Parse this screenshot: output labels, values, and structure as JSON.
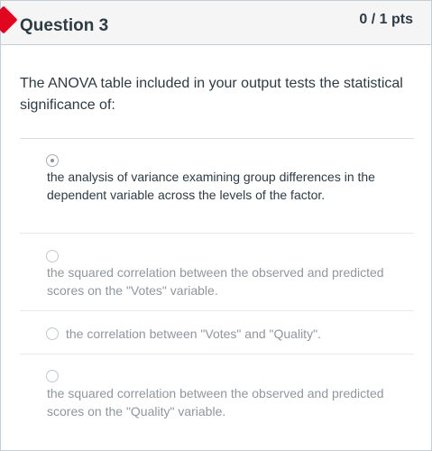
{
  "question": {
    "title": "Question 3",
    "points": "0 / 1 pts",
    "text": "The ANOVA table included in your output tests the statistical significance of:"
  },
  "answers": [
    {
      "label": "the analysis of variance examining group differences in the dependent variable across the levels of the factor.",
      "selected": true
    },
    {
      "label": "the squared correlation between the observed and predicted scores on the \"Votes\" variable.",
      "selected": false
    },
    {
      "label": "the correlation between \"Votes\" and \"Quality\".",
      "selected": false
    },
    {
      "label": "the squared correlation between the observed and predicted scores on the \"Quality\" variable.",
      "selected": false
    }
  ],
  "colors": {
    "flag": "#e0061f",
    "text": "#2d3b45",
    "muted_text": "#8f979d",
    "header_bg": "#f5f5f5"
  }
}
